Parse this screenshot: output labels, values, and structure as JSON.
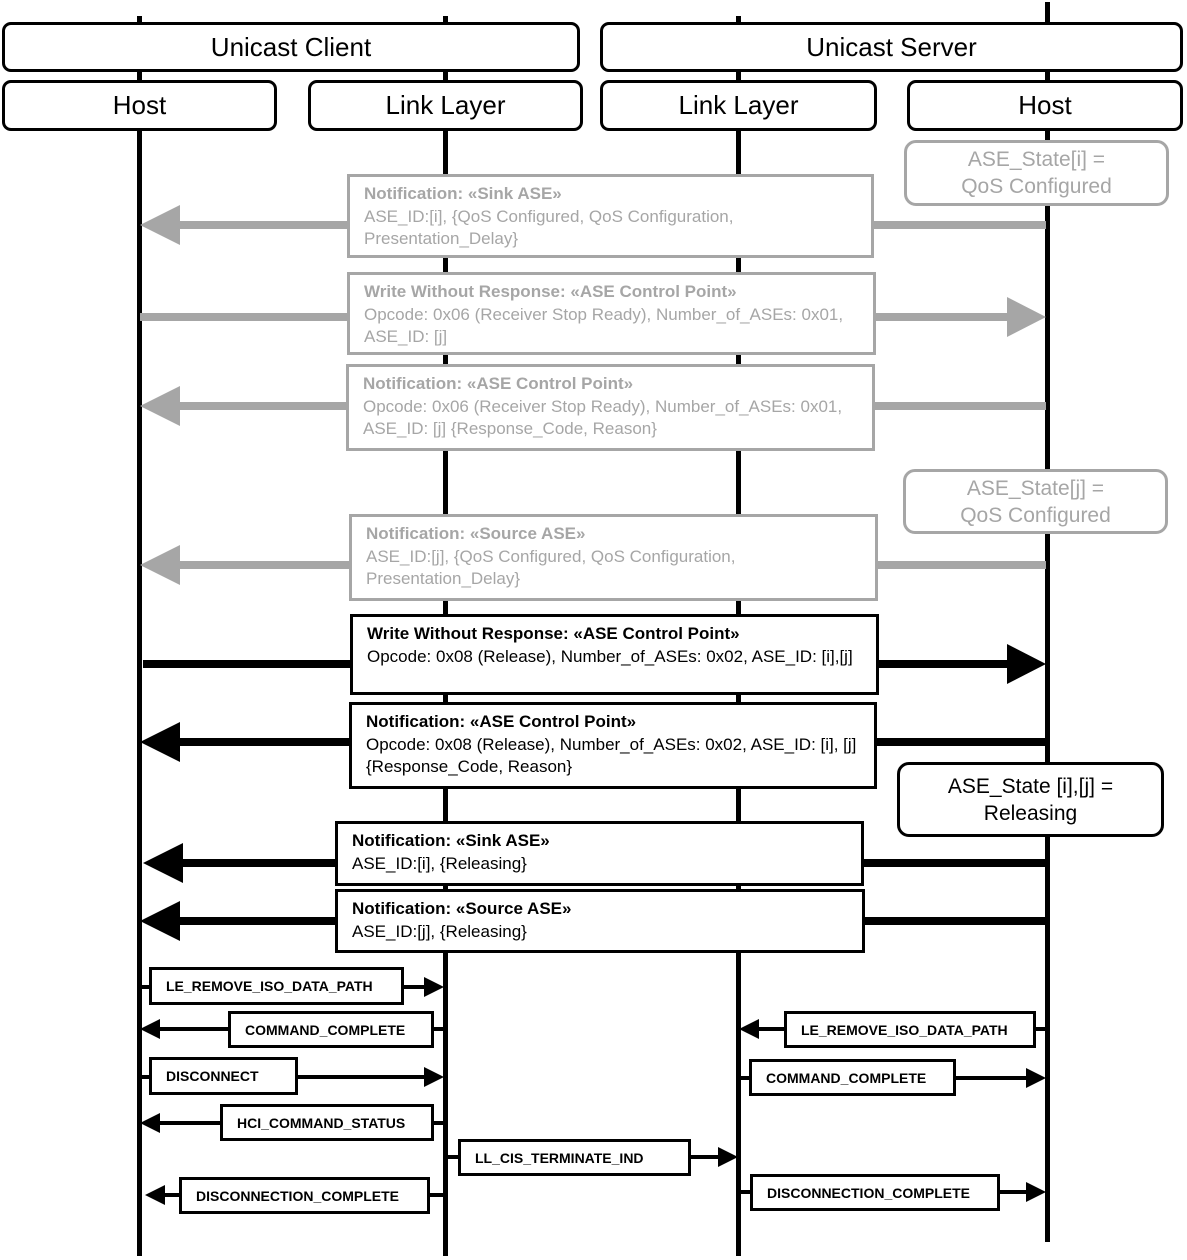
{
  "diagram": {
    "type": "sequence",
    "colors": {
      "active": "#000000",
      "inactive": "#a6a6a6",
      "background": "#ffffff"
    },
    "groups": [
      {
        "id": "client",
        "label": "Unicast Client"
      },
      {
        "id": "server",
        "label": "Unicast Server"
      }
    ],
    "lifelines": [
      {
        "id": "client_host",
        "label": "Host",
        "group": "client"
      },
      {
        "id": "client_ll",
        "label": "Link Layer",
        "group": "client"
      },
      {
        "id": "server_ll",
        "label": "Link Layer",
        "group": "server"
      },
      {
        "id": "server_host",
        "label": "Host",
        "group": "server"
      }
    ],
    "states": [
      {
        "id": "state_i_qos",
        "lines": [
          "ASE_State[i] =",
          "QoS Configured"
        ],
        "style": "inactive"
      },
      {
        "id": "state_j_qos",
        "lines": [
          "ASE_State[j] =",
          "QoS Configured"
        ],
        "style": "inactive"
      },
      {
        "id": "state_ij_releasing",
        "lines": [
          "ASE_State [i],[j] =",
          "Releasing"
        ],
        "style": "active"
      }
    ],
    "messages": [
      {
        "id": "m1",
        "title": "Notification: «Sink ASE»",
        "body": "ASE_ID:[i], {QoS Configured, QoS Configuration, Presentation_Delay}",
        "from": "server_host",
        "to": "client_host",
        "style": "inactive"
      },
      {
        "id": "m2",
        "title": "Write Without Response: «ASE Control Point»",
        "body": "Opcode: 0x06 (Receiver Stop Ready), Number_of_ASEs: 0x01, ASE_ID: [j]",
        "from": "client_host",
        "to": "server_host",
        "style": "inactive"
      },
      {
        "id": "m3",
        "title": "Notification: «ASE Control Point»",
        "body": "Opcode: 0x06 (Receiver Stop Ready), Number_of_ASEs: 0x01, ASE_ID: [j] {Response_Code, Reason}",
        "from": "server_host",
        "to": "client_host",
        "style": "inactive"
      },
      {
        "id": "m4",
        "title": "Notification: «Source ASE»",
        "body": "ASE_ID:[j], {QoS Configured, QoS Configuration, Presentation_Delay}",
        "from": "server_host",
        "to": "client_host",
        "style": "inactive"
      },
      {
        "id": "m5",
        "title": "Write Without Response: «ASE Control Point»",
        "body": "Opcode: 0x08 (Release), Number_of_ASEs: 0x02, ASE_ID: [i],[j]",
        "from": "client_host",
        "to": "server_host",
        "style": "active"
      },
      {
        "id": "m6",
        "title": "Notification: «ASE Control Point»",
        "body": "Opcode: 0x08 (Release), Number_of_ASEs: 0x02, ASE_ID: [i], [j] {Response_Code, Reason}",
        "from": "server_host",
        "to": "client_host",
        "style": "active"
      },
      {
        "id": "m7",
        "title": "Notification: «Sink ASE»",
        "body": "ASE_ID:[i], {Releasing}",
        "from": "server_host",
        "to": "client_host",
        "style": "active"
      },
      {
        "id": "m8",
        "title": "Notification: «Source ASE»",
        "body": "ASE_ID:[j], {Releasing}",
        "from": "server_host",
        "to": "client_host",
        "style": "active"
      }
    ],
    "hci_messages": [
      {
        "id": "h1",
        "label": "LE_REMOVE_ISO_DATA_PATH",
        "from": "client_host",
        "to": "client_ll"
      },
      {
        "id": "h2",
        "label": "COMMAND_COMPLETE",
        "from": "client_ll",
        "to": "client_host"
      },
      {
        "id": "h3",
        "label": "LE_REMOVE_ISO_DATA_PATH",
        "from": "server_host",
        "to": "server_ll"
      },
      {
        "id": "h4",
        "label": "DISCONNECT",
        "from": "client_host",
        "to": "client_ll"
      },
      {
        "id": "h5",
        "label": "COMMAND_COMPLETE",
        "from": "server_ll",
        "to": "server_host"
      },
      {
        "id": "h6",
        "label": "HCI_COMMAND_STATUS",
        "from": "client_ll",
        "to": "client_host"
      },
      {
        "id": "h7",
        "label": "LL_CIS_TERMINATE_IND",
        "from": "client_ll",
        "to": "server_ll"
      },
      {
        "id": "h8",
        "label": "DISCONNECTION_COMPLETE",
        "from": "server_ll",
        "to": "server_host"
      },
      {
        "id": "h9",
        "label": "DISCONNECTION_COMPLETE",
        "from": "client_ll",
        "to": "client_host"
      }
    ]
  }
}
